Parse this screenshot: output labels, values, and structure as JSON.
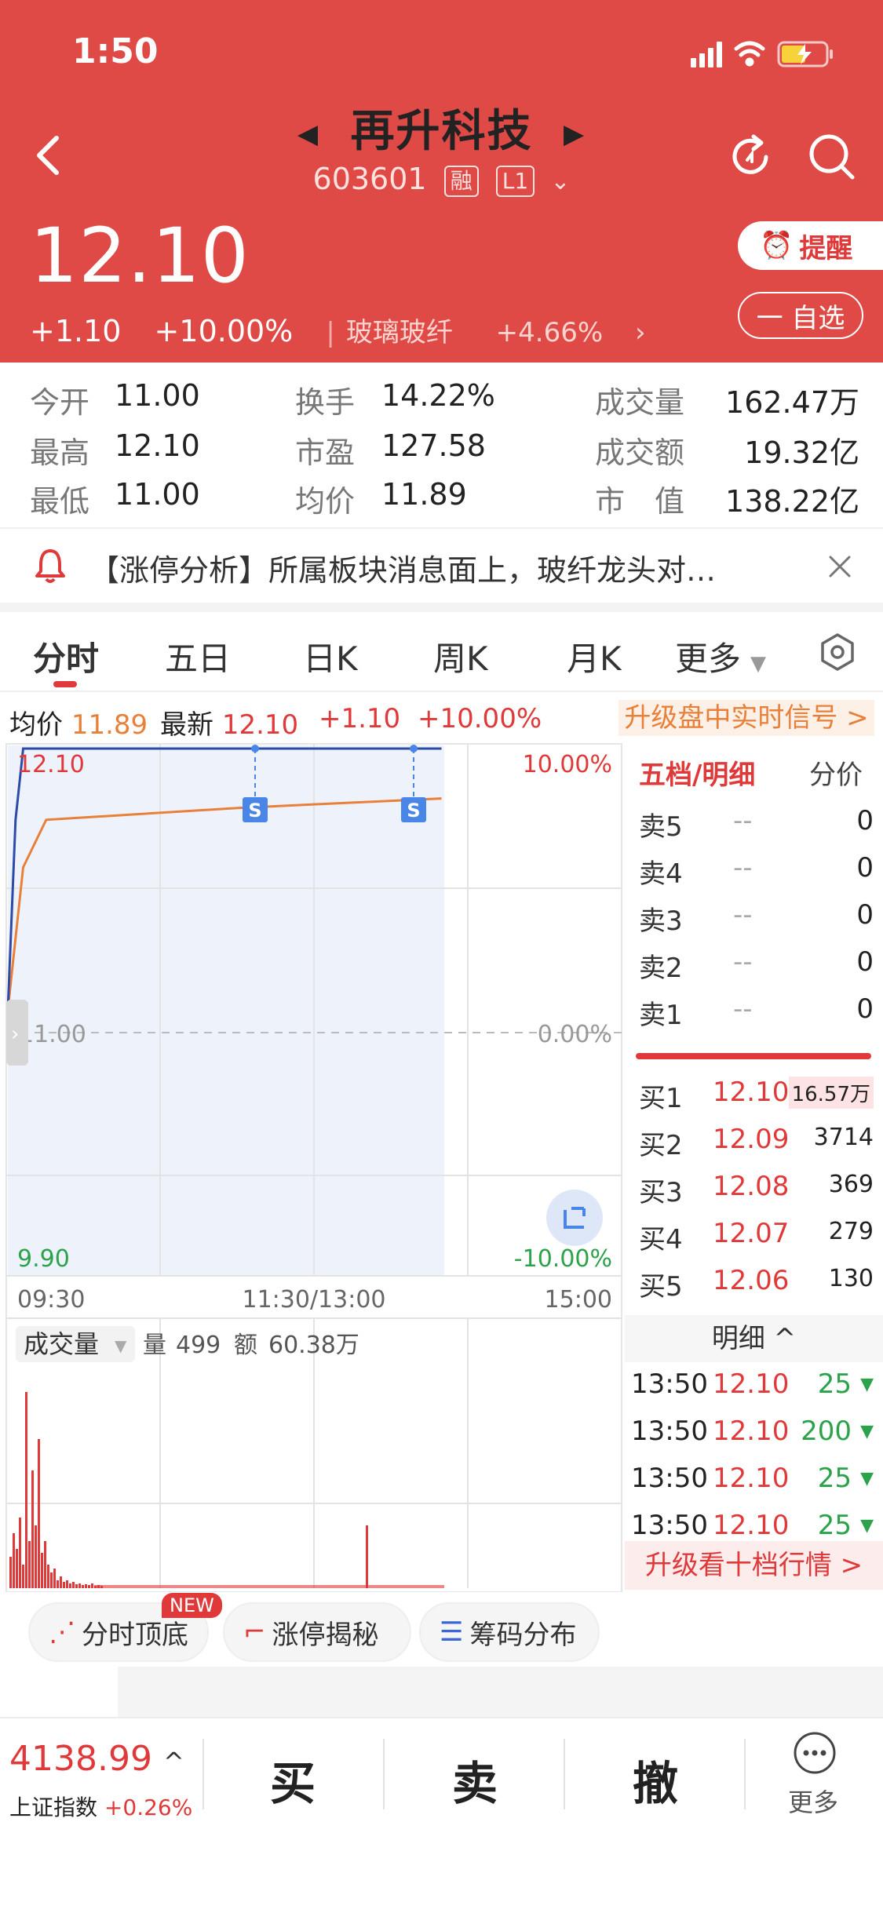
{
  "status": {
    "time": "1:50"
  },
  "header": {
    "stock_name": "再升科技",
    "code": "603601",
    "tag1": "融",
    "tag2": "L1",
    "price": "12.10",
    "change": "+1.10",
    "change_pct": "+10.00%",
    "sector_name": "玻璃玻纤",
    "sector_change": "+4.66%",
    "remind_label": "提醒",
    "watch_label": "一 自选"
  },
  "stats": {
    "open_label": "今开",
    "open": "11.00",
    "high_label": "最高",
    "high": "12.10",
    "low_label": "最低",
    "low": "11.00",
    "turnover_label": "换手",
    "turnover": "14.22%",
    "pe_label": "市盈",
    "pe": "127.58",
    "avg_label": "均价",
    "avg": "11.89",
    "volume_label": "成交量",
    "volume": "162.47万",
    "amount_label": "成交额",
    "amount": "19.32亿",
    "mcap_label": "市　值",
    "mcap": "138.22亿"
  },
  "news": {
    "text": "【涨停分析】所属板块消息面上，玻纤龙头对…"
  },
  "tabs": [
    "分时",
    "五日",
    "日K",
    "周K",
    "月K",
    "更多"
  ],
  "quote_line": {
    "avg_label": "均价",
    "avg": "11.89",
    "latest_label": "最新",
    "latest": "12.10",
    "change": "+1.10",
    "change_pct": "+10.00%",
    "upgrade": "升级盘中实时信号 >"
  },
  "chart": {
    "price_top": "12.10",
    "pct_top": "10.00%",
    "price_mid": "11.00",
    "pct_mid": "0.00%",
    "price_bottom": "9.90",
    "pct_bottom": "-10.00%",
    "time_start": "09:30",
    "time_mid": "11:30/13:00",
    "time_end": "15:00",
    "marker": "S",
    "volume_label": "成交量",
    "vol_label": "量",
    "vol": "499",
    "amt_label": "额",
    "amt": "60.38万"
  },
  "chart_data": {
    "type": "line",
    "title": "",
    "x_range": [
      "09:30",
      "15:00"
    ],
    "ylim": [
      9.9,
      12.1
    ],
    "series": [
      {
        "name": "最新",
        "values_note": "",
        "points": [
          [
            "09:30",
            11.0
          ],
          [
            "09:33",
            11.8
          ],
          [
            "09:36",
            12.1
          ],
          [
            "13:50",
            12.1
          ]
        ]
      },
      {
        "name": "均价",
        "points": [
          [
            "09:30",
            11.0
          ],
          [
            "09:36",
            11.6
          ],
          [
            "09:45",
            11.8
          ],
          [
            "11:00",
            11.85
          ],
          [
            "13:50",
            11.89
          ]
        ]
      }
    ]
  },
  "order_book": {
    "title": "五档/明细",
    "alt": "分价",
    "asks": [
      {
        "label": "卖5",
        "price": "--",
        "vol": "0"
      },
      {
        "label": "卖4",
        "price": "--",
        "vol": "0"
      },
      {
        "label": "卖3",
        "price": "--",
        "vol": "0"
      },
      {
        "label": "卖2",
        "price": "--",
        "vol": "0"
      },
      {
        "label": "卖1",
        "price": "--",
        "vol": "0"
      }
    ],
    "bids": [
      {
        "label": "买1",
        "price": "12.10",
        "vol": "16.57万"
      },
      {
        "label": "买2",
        "price": "12.09",
        "vol": "3714"
      },
      {
        "label": "买3",
        "price": "12.08",
        "vol": "369"
      },
      {
        "label": "买4",
        "price": "12.07",
        "vol": "279"
      },
      {
        "label": "买5",
        "price": "12.06",
        "vol": "130"
      }
    ],
    "detail_label": "明细 ^",
    "ticks": [
      {
        "time": "13:50",
        "price": "12.10",
        "vol": "25"
      },
      {
        "time": "13:50",
        "price": "12.10",
        "vol": "200"
      },
      {
        "time": "13:50",
        "price": "12.10",
        "vol": "25"
      },
      {
        "time": "13:50",
        "price": "12.10",
        "vol": "25"
      }
    ],
    "upgrade": "升级看十档行情 >"
  },
  "tools": {
    "new_badge": "NEW",
    "t1": "分时顶底",
    "t2": "涨停揭秘",
    "t3": "筹码分布"
  },
  "bottom": {
    "index_value": "4138.99",
    "index_name": "上证指数",
    "index_change": "+0.26%",
    "buy": "买",
    "sell": "卖",
    "cancel": "撤",
    "more": "更多"
  }
}
